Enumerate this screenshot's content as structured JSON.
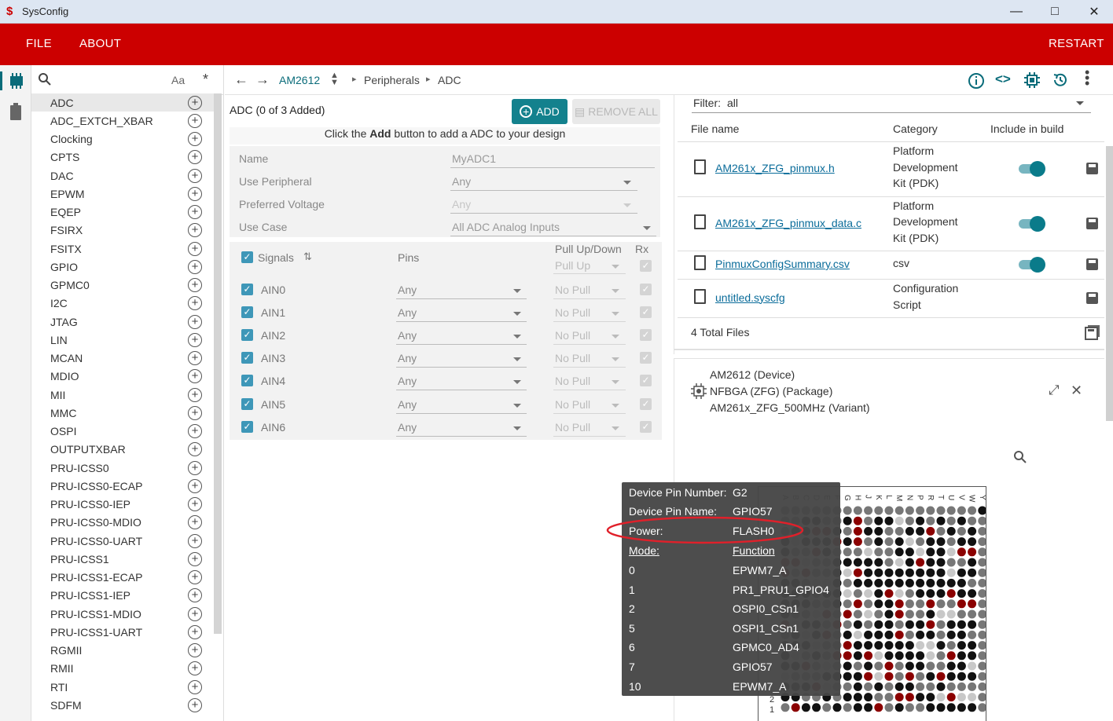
{
  "app": {
    "title": "SysConfig"
  },
  "menu": {
    "file": "FILE",
    "about": "ABOUT",
    "restart": "RESTART"
  },
  "search": {
    "case_label": "Aa",
    "regex_label": "*"
  },
  "sidebar": {
    "items": [
      "ADC",
      "ADC_EXTCH_XBAR",
      "Clocking",
      "CPTS",
      "DAC",
      "EPWM",
      "EQEP",
      "FSIRX",
      "FSITX",
      "GPIO",
      "GPMC0",
      "I2C",
      "JTAG",
      "LIN",
      "MCAN",
      "MDIO",
      "MII",
      "MMC",
      "OSPI",
      "OUTPUTXBAR",
      "PRU-ICSS0",
      "PRU-ICSS0-ECAP",
      "PRU-ICSS0-IEP",
      "PRU-ICSS0-MDIO",
      "PRU-ICSS0-UART",
      "PRU-ICSS1",
      "PRU-ICSS1-ECAP",
      "PRU-ICSS1-IEP",
      "PRU-ICSS1-MDIO",
      "PRU-ICSS1-UART",
      "RGMII",
      "RMII",
      "RTI",
      "SDFM"
    ]
  },
  "breadcrumb": {
    "device": "AM2612",
    "section": "Peripherals",
    "module": "ADC"
  },
  "adc": {
    "header": "ADC (0 of 3 Added)",
    "add_label": "ADD",
    "remove_label": "REMOVE ALL",
    "hint_pre": "Click the ",
    "hint_bold": "Add",
    "hint_post": " button to add a ADC to your design",
    "fields": [
      {
        "label": "Name",
        "value": "MyADC1"
      },
      {
        "label": "Use Peripheral",
        "value": "Any"
      },
      {
        "label": "Preferred Voltage",
        "value": "Any"
      },
      {
        "label": "Use Case",
        "value": "All ADC Analog Inputs"
      }
    ],
    "signals_header": "Signals",
    "pins_header": "Pins",
    "pull_header": "Pull Up/Down",
    "rx_header": "Rx",
    "pull_default": "Pull Up",
    "signals": [
      {
        "name": "AIN0",
        "pin": "Any",
        "pull": "No Pull"
      },
      {
        "name": "AIN1",
        "pin": "Any",
        "pull": "No Pull"
      },
      {
        "name": "AIN2",
        "pin": "Any",
        "pull": "No Pull"
      },
      {
        "name": "AIN3",
        "pin": "Any",
        "pull": "No Pull"
      },
      {
        "name": "AIN4",
        "pin": "Any",
        "pull": "No Pull"
      },
      {
        "name": "AIN5",
        "pin": "Any",
        "pull": "No Pull"
      },
      {
        "name": "AIN6",
        "pin": "Any",
        "pull": "No Pull"
      }
    ]
  },
  "files": {
    "filter_label": "Filter:",
    "filter_value": "all",
    "col_name": "File name",
    "col_category": "Category",
    "col_include": "Include in build",
    "rows": [
      {
        "name": "AM261x_ZFG_pinmux.h",
        "category": [
          "Platform",
          "Development",
          "Kit (PDK)"
        ],
        "include": true
      },
      {
        "name": "AM261x_ZFG_pinmux_data.c",
        "category": [
          "Platform",
          "Development",
          "Kit (PDK)"
        ],
        "include": true
      },
      {
        "name": "PinmuxConfigSummary.csv",
        "category": [
          "csv"
        ],
        "include": true
      },
      {
        "name": "untitled.syscfg",
        "category": [
          "Configuration",
          "Script"
        ],
        "include": false
      }
    ],
    "total": "4 Total Files"
  },
  "device": {
    "line1": "AM2612 (Device)",
    "line2": "NFBGA (ZFG) (Package)",
    "line3": "AM261x_ZFG_500MHz (Variant)"
  },
  "package": {
    "col_letters": "ABCDEFGHJKLMNPRTUVWY",
    "row_labels": [
      "2",
      "1"
    ]
  },
  "tooltip": {
    "pin_number_label": "Device Pin Number:",
    "pin_number": "G2",
    "pin_name_label": "Device Pin Name:",
    "pin_name": "GPIO57",
    "power_label": "Power:",
    "power": "FLASH0",
    "mode_label": "Mode:",
    "function_label": "Function",
    "modes": [
      {
        "mode": "0",
        "function": "EPWM7_A"
      },
      {
        "mode": "1",
        "function": "PR1_PRU1_GPIO4"
      },
      {
        "mode": "2",
        "function": "OSPI0_CSn1"
      },
      {
        "mode": "5",
        "function": "OSPI1_CSn1"
      },
      {
        "mode": "6",
        "function": "GPMC0_AD4"
      },
      {
        "mode": "7",
        "function": "GPIO57"
      },
      {
        "mode": "10",
        "function": "EPWM7_A"
      }
    ]
  },
  "colors": {
    "brand_red": "#cc0000",
    "accent_teal": "#13818d",
    "highlight_circle": "#e0202a"
  }
}
